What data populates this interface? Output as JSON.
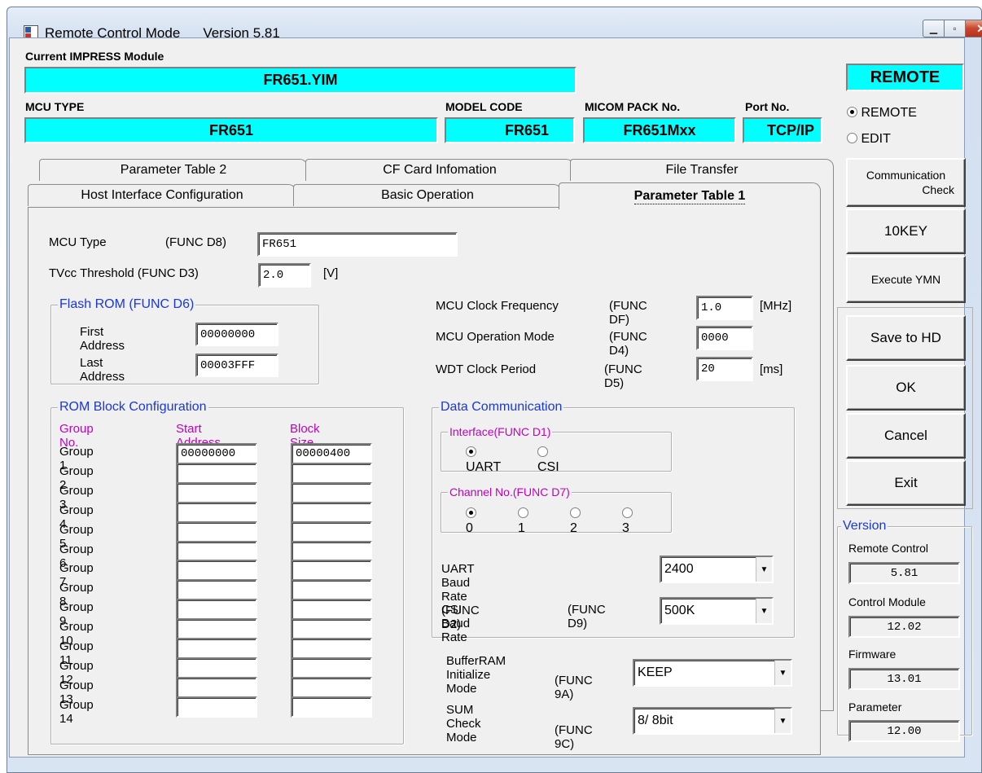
{
  "window": {
    "title": "Remote Control Mode",
    "version": "Version  5.81",
    "minimize": "▁",
    "maximize": "▫",
    "close": "✕"
  },
  "module": {
    "label": "Current IMPRESS Module",
    "value": "FR651.YIM"
  },
  "mode_badge": "REMOTE",
  "mcu_type": {
    "label": "MCU TYPE",
    "value": "FR651"
  },
  "model_code": {
    "label": "MODEL CODE",
    "value": "FR651"
  },
  "micom_pack": {
    "label": "MICOM PACK No.",
    "value": "FR651Mxx"
  },
  "port": {
    "label": "Port No.",
    "value": "TCP/IP"
  },
  "mode_options": {
    "remote": "REMOTE",
    "edit": "EDIT",
    "selected": "REMOTE"
  },
  "tabs": {
    "row1": [
      "Parameter Table 2",
      "CF Card Infomation",
      "File Transfer"
    ],
    "row2": [
      "Host Interface Configuration",
      "Basic Operation",
      "Parameter Table 1"
    ],
    "active": "Parameter Table 1"
  },
  "params": {
    "mcu_type_label": "MCU Type",
    "mcu_type_func": "(FUNC D8)",
    "mcu_type_value": "FR651",
    "tvcc_label": "TVcc Threshold (FUNC D3)",
    "tvcc_value": "2.0",
    "tvcc_unit": "[V]"
  },
  "flash_rom": {
    "title": "Flash ROM (FUNC D6)",
    "first_label": "First Address",
    "first_value": "00000000",
    "last_label": "Last Address",
    "last_value": "00003FFF"
  },
  "clock": {
    "freq_label": "MCU Clock Frequency",
    "freq_func": "(FUNC DF)",
    "freq_value": "1.0",
    "freq_unit": "[MHz]",
    "opmode_label": "MCU Operation Mode",
    "opmode_func": "(FUNC D4)",
    "opmode_value": "0000",
    "wdt_label": "WDT Clock Period",
    "wdt_func": "(FUNC D5)",
    "wdt_value": "20",
    "wdt_unit": "[ms]"
  },
  "rom_block": {
    "title": "ROM Block Configuration",
    "col_group": "Group No.",
    "col_start": "Start Address",
    "col_size": "Block Size (byte)",
    "groups": [
      {
        "name": "Group  1",
        "start": "00000000",
        "size": "00000400"
      },
      {
        "name": "Group  2",
        "start": "",
        "size": ""
      },
      {
        "name": "Group  3",
        "start": "",
        "size": ""
      },
      {
        "name": "Group  4",
        "start": "",
        "size": ""
      },
      {
        "name": "Group  5",
        "start": "",
        "size": ""
      },
      {
        "name": "Group  6",
        "start": "",
        "size": ""
      },
      {
        "name": "Group  7",
        "start": "",
        "size": ""
      },
      {
        "name": "Group  8",
        "start": "",
        "size": ""
      },
      {
        "name": "Group  9",
        "start": "",
        "size": ""
      },
      {
        "name": "Group 10",
        "start": "",
        "size": ""
      },
      {
        "name": "Group 11",
        "start": "",
        "size": ""
      },
      {
        "name": "Group 12",
        "start": "",
        "size": ""
      },
      {
        "name": "Group 13",
        "start": "",
        "size": ""
      },
      {
        "name": "Group 14",
        "start": "",
        "size": ""
      }
    ]
  },
  "data_comm": {
    "title": "Data Communication",
    "interface_title": "Interface(FUNC D1)",
    "interface_options": [
      "UART",
      "CSI"
    ],
    "interface_selected": "UART",
    "channel_title": "Channel No.(FUNC D7)",
    "channel_options": [
      "0",
      "1",
      "2",
      "3"
    ],
    "channel_selected": "0",
    "uart_label": "UART Baud Rate (FUNC D2)",
    "uart_value": "2400",
    "csi_label": "CSI Baud Rate",
    "csi_func": "(FUNC D9)",
    "csi_value": "500K"
  },
  "buffer_ram": {
    "label": "BufferRAM Initialize Mode",
    "func": "(FUNC 9A)",
    "value": "KEEP"
  },
  "sum_check": {
    "label": "SUM Check Mode",
    "func": "(FUNC 9C)",
    "value": "8/ 8bit"
  },
  "side_buttons": {
    "comm_check_1": "Communication",
    "comm_check_2": "Check",
    "tenkey": "10KEY",
    "execute_ymn": "Execute YMN",
    "save": "Save to HD",
    "ok": "OK",
    "cancel": "Cancel",
    "exit": "Exit"
  },
  "version_panel": {
    "title": "Version",
    "remote_label": "Remote Control",
    "remote_value": "5.81",
    "module_label": "Control Module",
    "module_value": "12.02",
    "firmware_label": "Firmware",
    "firmware_value": "13.01",
    "parameter_label": "Parameter",
    "parameter_value": "12.00"
  }
}
